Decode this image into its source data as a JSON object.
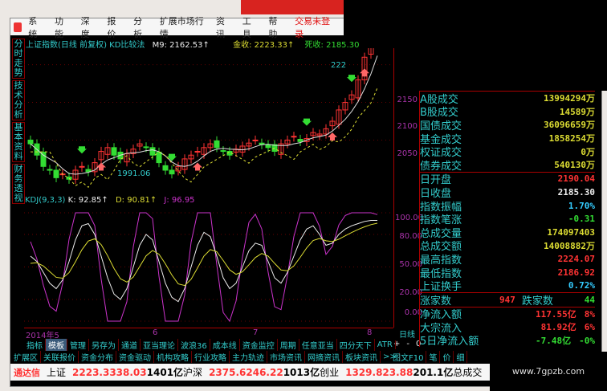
{
  "menu": [
    "系统",
    "功能",
    "深度",
    "报价",
    "分析",
    "扩展市场行情",
    "资讯",
    "工具",
    "帮助"
  ],
  "menu_trade": "交易未登录",
  "side_tabs": [
    "分时走势",
    "技术分析",
    "基本资料",
    "财务透视"
  ],
  "header": {
    "title": "上证指数(日线 前复权) KD比较法",
    "m9": "M9: 2162.53↑",
    "jin": "金收: 2223.33↑",
    "si": "死收: 2185.30",
    "cut_price": "222",
    "low_label": "1991.06"
  },
  "kdj": {
    "name": "KDJ(9,3,3)",
    "k": "K: 92.85↑",
    "d": "D: 90.81↑",
    "j": "J: 96.95"
  },
  "price_axis": [
    "2150",
    "2100",
    "2050"
  ],
  "kdj_axis": [
    "100.00",
    "80.00",
    "50.00",
    "20.00",
    "0.00"
  ],
  "dates": [
    "2014年5",
    "6",
    "7",
    "8"
  ],
  "period": "日线",
  "zoom_btns": [
    "+",
    "-",
    "0"
  ],
  "tabs1": [
    "指标",
    "模板",
    "管理",
    "另存为",
    "通道",
    "亚当理论",
    "波浪36",
    "成本线",
    "资金监控",
    "周期",
    "任意亚当",
    "四分天下",
    "ATR"
  ],
  "tabs2": [
    "扩展区",
    "关联报价",
    "资金分布",
    "资金驱动",
    "机构攻略",
    "行业攻略",
    "主力轨迹",
    "市场资讯",
    "网摘资讯",
    "板块资讯",
    ">>"
  ],
  "tabs_right": [
    "图文F10",
    "笔",
    "价",
    "细"
  ],
  "info": {
    "top": [
      [
        "A股成交",
        "13994294万"
      ],
      [
        "B股成交",
        "14589万"
      ],
      [
        "国债成交",
        "36096659万"
      ],
      [
        "基金成交",
        "1858254万"
      ],
      [
        "权证成交",
        "0万"
      ],
      [
        "债券成交",
        "540130万"
      ]
    ],
    "mid": [
      [
        "日开盘",
        "2190.04",
        "#f33"
      ],
      [
        "日收盘",
        "2185.30",
        "#eee"
      ],
      [
        "指数振幅",
        "1.70%",
        "#3cf"
      ],
      [
        "指数笔涨",
        "-0.31",
        "#3d3"
      ],
      [
        "总成交量",
        "174097403",
        "#dd3"
      ],
      [
        "总成交额",
        "14008882万",
        "#dd3"
      ],
      [
        "最高指数",
        "2224.07",
        "#f33"
      ],
      [
        "最低指数",
        "2186.92",
        "#f33"
      ],
      [
        "上证换手",
        "0.72%",
        "#3cf"
      ]
    ],
    "up_label": "涨家数",
    "up": "947",
    "down_label": "跌家数",
    "down": "44",
    "flows": [
      [
        "净流入额",
        "117.55亿",
        "8%",
        "#f33"
      ],
      [
        "大宗流入",
        "81.92亿",
        "6%",
        "#f33"
      ],
      [
        "5日净流入额",
        "-7.48亿",
        "-0%",
        "#3d3"
      ]
    ]
  },
  "status": {
    "brand": "通达信",
    "sh": "上证",
    "sh_v": "2223.33",
    "sh_c": "38.03",
    "sh_a": "1401亿",
    "hs": "沪深",
    "hs_v": "2375.62",
    "hs_c": "46.22",
    "hs_a": "1013亿",
    "cy": "创业",
    "cy_v": "1329.82",
    "cy_c": "3.88",
    "cy_a": "201.1亿",
    "total": "总成交"
  },
  "watermark": "www.7gpzb.com",
  "chart_data": {
    "type": "candlestick",
    "ylim": [
      1978,
      2172
    ],
    "close": [
      2045,
      2030,
      2015,
      2010,
      2000,
      2005,
      1998,
      2010,
      2015,
      2008,
      2020,
      2035,
      2040,
      2030,
      2025,
      2032,
      2038,
      2045,
      2040,
      2030,
      2020,
      2010,
      2005,
      2015,
      2025,
      2030,
      2035,
      2040,
      2045,
      2040,
      2035,
      2030,
      2038,
      2042,
      2046,
      2050,
      2044,
      2040,
      2035,
      2045,
      2050,
      2055,
      2048,
      2052,
      2060,
      2058,
      2065,
      2075,
      2090,
      2100,
      2110,
      2130,
      2160,
      2190,
      2220
    ],
    "buy_signals": [
      11,
      26,
      47,
      52
    ],
    "sell_signals": [
      8,
      22,
      43,
      50
    ],
    "k": [
      60,
      55,
      45,
      35,
      30,
      38,
      55,
      75,
      88,
      90,
      80,
      60,
      40,
      25,
      20,
      30,
      50,
      70,
      80,
      75,
      55,
      35,
      22,
      18,
      30,
      50,
      70,
      82,
      78,
      60,
      40,
      30,
      35,
      50,
      65,
      72,
      70,
      55,
      40,
      35,
      45,
      60,
      75,
      85,
      88,
      80,
      70,
      72,
      80,
      85,
      88,
      90,
      92,
      93,
      93
    ]
  }
}
